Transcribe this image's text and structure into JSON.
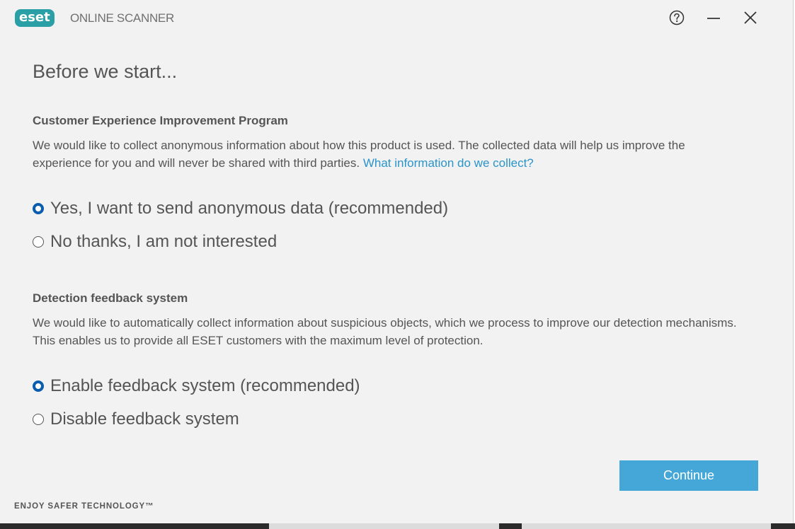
{
  "titlebar": {
    "logo_text": "eset",
    "product_name": "ONLINE SCANNER",
    "help_icon": "question-circle-icon",
    "minimize_icon": "minimize-icon",
    "close_icon": "close-icon"
  },
  "heading": "Before we start...",
  "ceip": {
    "title": "Customer Experience Improvement Program",
    "text": "We would like to collect anonymous information about how this product is used. The collected data will help us improve the experience for you and will never be shared with third parties. ",
    "link": "What information do we collect?",
    "options": [
      {
        "label": "Yes, I want to send anonymous data (recommended)",
        "checked": true
      },
      {
        "label": "No thanks, I am not interested",
        "checked": false
      }
    ]
  },
  "feedback": {
    "title": "Detection feedback system",
    "text": "We would like to automatically collect information about suspicious objects, which we process to improve our detection mechanisms. This enables us to provide all ESET customers with the maximum level of protection.",
    "options": [
      {
        "label": "Enable feedback system (recommended)",
        "checked": true
      },
      {
        "label": "Disable feedback system",
        "checked": false
      }
    ]
  },
  "continue_label": "Continue",
  "tagline": "ENJOY SAFER TECHNOLOGY™",
  "colors": {
    "brand": "#2a9fa6",
    "accent": "#45a7d8",
    "link": "#2b94c9",
    "radio_selected": "#0a5cae",
    "background": "#f2f2f2"
  }
}
